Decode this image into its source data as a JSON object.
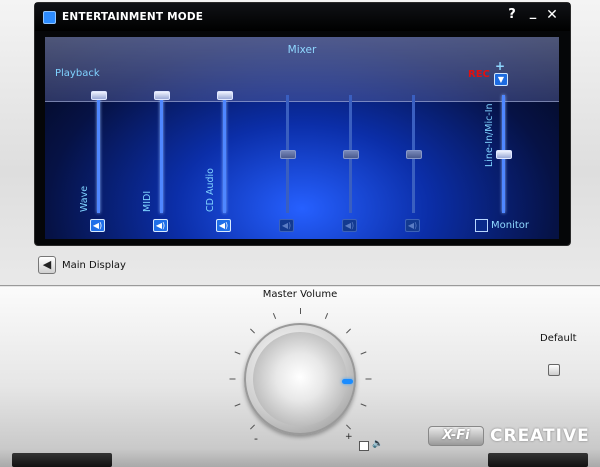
{
  "window": {
    "title": "ENTERTAINMENT MODE",
    "help_label": "?",
    "minimize_label": "_",
    "close_label": "✕"
  },
  "mixer": {
    "title": "Mixer",
    "playback_label": "Playback",
    "rec_label": "REC",
    "rec_plus": "+",
    "channels": [
      {
        "label": "Wave",
        "level": 1.0,
        "enabled": true
      },
      {
        "label": "MIDI",
        "level": 1.0,
        "enabled": true
      },
      {
        "label": "CD Audio",
        "level": 1.0,
        "enabled": true
      },
      {
        "label": "",
        "level": 0.5,
        "enabled": false
      },
      {
        "label": "",
        "level": 0.5,
        "enabled": false
      },
      {
        "label": "",
        "level": 0.5,
        "enabled": false
      },
      {
        "label": "Line-In/Mic-In",
        "level": 0.5,
        "enabled": true
      }
    ],
    "monitor_label": "Monitor"
  },
  "nav": {
    "main_display_label": "Main Display"
  },
  "master": {
    "label": "Master Volume",
    "minus": "-",
    "plus": "+",
    "speaker_glyph": "🔈"
  },
  "default_label": "Default",
  "brand": {
    "badge": "X-Fi",
    "name": "CREATIVE"
  },
  "colors": {
    "accent": "#2d8cff",
    "rec": "#e01010",
    "mixer_text": "#7fd2ff"
  }
}
